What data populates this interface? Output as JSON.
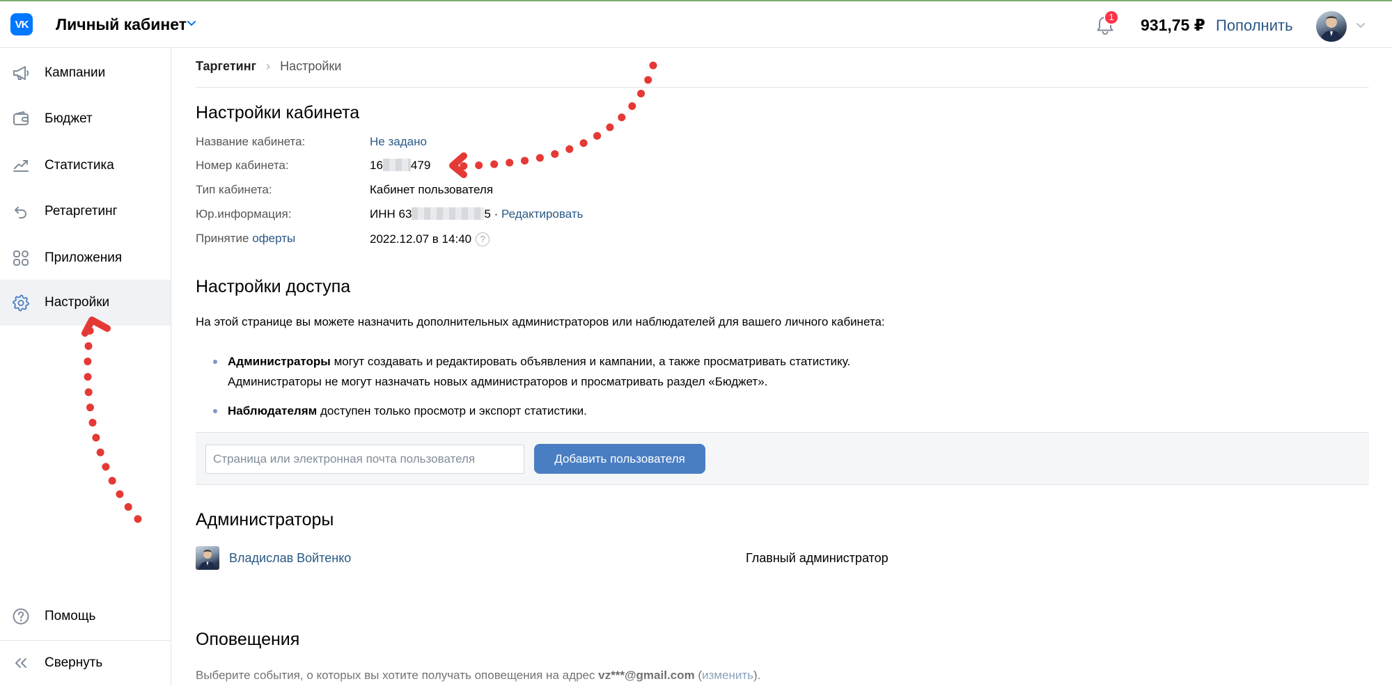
{
  "header": {
    "logo_text": "VK",
    "cabinet_title": "Личный кабинет",
    "notification_count": "1",
    "balance": "931,75 ₽",
    "topup_label": "Пополнить"
  },
  "sidebar": {
    "items": [
      {
        "label": "Кампании",
        "icon": "megaphone-icon"
      },
      {
        "label": "Бюджет",
        "icon": "wallet-icon"
      },
      {
        "label": "Статистика",
        "icon": "chart-line-icon"
      },
      {
        "label": "Ретаргетинг",
        "icon": "retarget-arrow-icon"
      },
      {
        "label": "Приложения",
        "icon": "apps-grid-icon"
      },
      {
        "label": "Настройки",
        "icon": "gear-icon",
        "active": true
      }
    ],
    "bottom": [
      {
        "label": "Помощь",
        "icon": "help-circle-icon"
      },
      {
        "label": "Свернуть",
        "icon": "collapse-chevrons-icon"
      }
    ]
  },
  "breadcrumbs": [
    "Таргетинг",
    "Настройки"
  ],
  "cabinet_settings": {
    "title": "Настройки кабинета",
    "name_label": "Название кабинета:",
    "name_value": "Не задано",
    "number_label": "Номер кабинета:",
    "number_prefix": "16",
    "number_suffix": "479",
    "type_label": "Тип кабинета:",
    "type_value": "Кабинет пользователя",
    "legal_label": "Юр.информация:",
    "legal_prefix": "ИНН 63",
    "legal_suffix": "5",
    "legal_sep": "·",
    "legal_edit": "Редактировать",
    "offer_label_prefix": "Принятие",
    "offer_label_link": "оферты",
    "offer_value": "2022.12.07 в 14:40",
    "offer_help": "?"
  },
  "access_settings": {
    "title": "Настройки доступа",
    "intro": "На этой странице вы можете назначить дополнительных администраторов или наблюдателей для вашего личного кабинета:",
    "admins_bold": "Администраторы",
    "admins_text_1": "могут создавать и редактировать объявления и кампании, а также просматривать статистику.",
    "admins_text_2": "Администраторы не могут назначать новых администраторов и просматривать раздел «Бюджет».",
    "observers_bold": "Наблюдателям",
    "observers_text": "доступен только просмотр и экспорт статистики.",
    "input_placeholder": "Страница или электронная почта пользователя",
    "add_button": "Добавить пользователя"
  },
  "administrators": {
    "title": "Администраторы",
    "rows": [
      {
        "name": "Владислав Войтенко",
        "role": "Главный администратор"
      }
    ]
  },
  "notifications": {
    "title": "Оповещения",
    "text_prefix": "Выберите события, о которых вы хотите получать оповещения на адрес",
    "email": "vz***@gmail.com",
    "paren_open": "(",
    "change_link": "изменить",
    "paren_close": ")."
  },
  "colors": {
    "accent_link": "#2a5885",
    "button": "#4a7ec3",
    "vk_blue": "#0077ff",
    "badge": "#ff3347",
    "annotation_red": "#e53935"
  }
}
